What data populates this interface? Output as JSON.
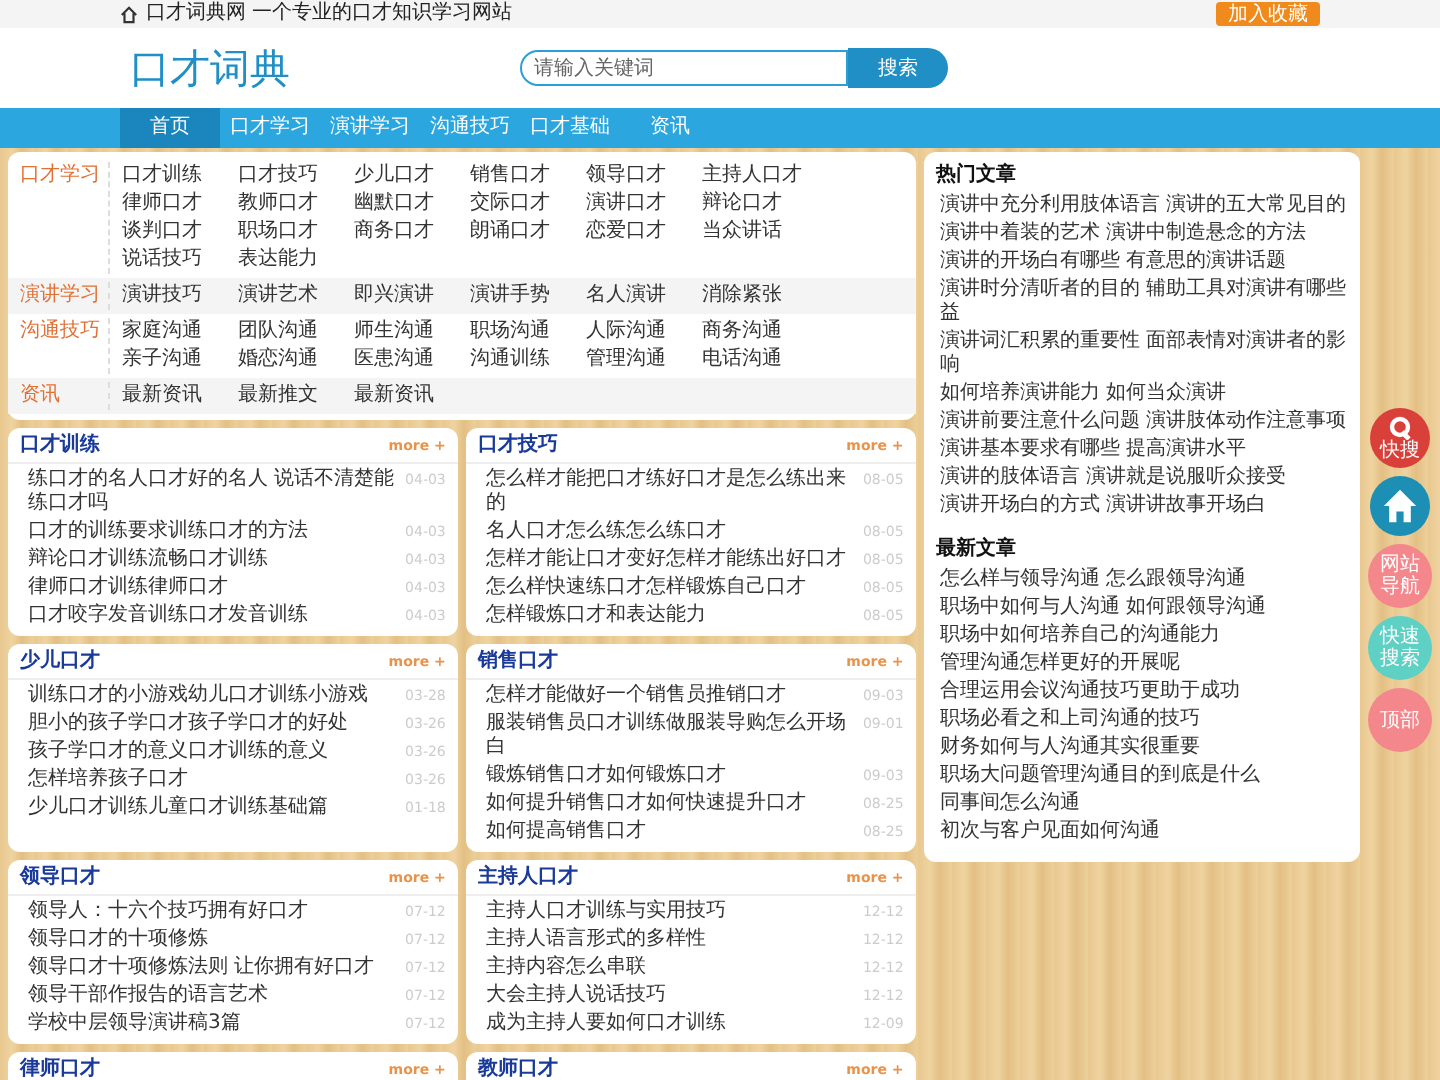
{
  "top_bar": {
    "site_intro": "口才词典网 一个专业的口才知识学习网站",
    "bookmark_button": "加入收藏"
  },
  "header": {
    "logo": "口才词典",
    "search": {
      "placeholder": "请输入关键词"
    },
    "search_button": "搜索"
  },
  "nav": [
    {
      "label": "首页",
      "selected": true
    },
    {
      "label": "口才学习",
      "selected": false
    },
    {
      "label": "演讲学习",
      "selected": false
    },
    {
      "label": "沟通技巧",
      "selected": false
    },
    {
      "label": "口才基础",
      "selected": false
    },
    {
      "label": "资讯",
      "selected": false
    }
  ],
  "categories": [
    {
      "label": "口才学习",
      "links": [
        "口才训练",
        "口才技巧",
        "少儿口才",
        "销售口才",
        "领导口才",
        "主持人口才",
        "律师口才",
        "教师口才",
        "幽默口才",
        "交际口才",
        "演讲口才",
        "辩论口才",
        "谈判口才",
        "职场口才",
        "商务口才",
        "朗诵口才",
        "恋爱口才",
        "当众讲话",
        "说话技巧",
        "表达能力"
      ]
    },
    {
      "label": "演讲学习",
      "links": [
        "演讲技巧",
        "演讲艺术",
        "即兴演讲",
        "演讲手势",
        "名人演讲",
        "消除紧张"
      ]
    },
    {
      "label": "沟通技巧",
      "links": [
        "家庭沟通",
        "团队沟通",
        "师生沟通",
        "职场沟通",
        "人际沟通",
        "商务沟通",
        "亲子沟通",
        "婚恋沟通",
        "医患沟通",
        "沟通训练",
        "管理沟通",
        "电话沟通"
      ]
    },
    {
      "label": "资讯",
      "links": [
        "最新资讯",
        "最新推文",
        "最新资讯"
      ]
    }
  ],
  "sections": [
    {
      "title": "口才训练",
      "more": "more +",
      "articles": [
        {
          "title": "练口才的名人口才好的名人 说话不清楚能练口才吗",
          "date": "04-03"
        },
        {
          "title": "口才的训练要求训练口才的方法",
          "date": "04-03"
        },
        {
          "title": "辩论口才训练流畅口才训练",
          "date": "04-03"
        },
        {
          "title": "律师口才训练律师口才",
          "date": "04-03"
        },
        {
          "title": "口才咬字发音训练口才发音训练",
          "date": "04-03"
        }
      ]
    },
    {
      "title": "口才技巧",
      "more": "more +",
      "articles": [
        {
          "title": "怎么样才能把口才练好口才是怎么练出来的",
          "date": "08-05"
        },
        {
          "title": "名人口才怎么练怎么练口才",
          "date": "08-05"
        },
        {
          "title": "怎样才能让口才变好怎样才能练出好口才",
          "date": "08-05"
        },
        {
          "title": "怎么样快速练口才怎样锻炼自己口才",
          "date": "08-05"
        },
        {
          "title": "怎样锻炼口才和表达能力",
          "date": "08-05"
        }
      ]
    },
    {
      "title": "少儿口才",
      "more": "more +",
      "articles": [
        {
          "title": "训练口才的小游戏幼儿口才训练小游戏",
          "date": "03-28"
        },
        {
          "title": "胆小的孩子学口才孩子学口才的好处",
          "date": "03-26"
        },
        {
          "title": "孩子学口才的意义口才训练的意义",
          "date": "03-26"
        },
        {
          "title": "怎样培养孩子口才",
          "date": "03-26"
        },
        {
          "title": "少儿口才训练儿童口才训练基础篇",
          "date": "01-18"
        }
      ]
    },
    {
      "title": "销售口才",
      "more": "more +",
      "articles": [
        {
          "title": "怎样才能做好一个销售员推销口才",
          "date": "09-03"
        },
        {
          "title": "服装销售员口才训练做服装导购怎么开场白",
          "date": "09-01"
        },
        {
          "title": "锻炼销售口才如何锻炼口才",
          "date": "09-03"
        },
        {
          "title": "如何提升销售口才如何快速提升口才",
          "date": "08-25"
        },
        {
          "title": "如何提高销售口才",
          "date": "08-25"
        }
      ]
    },
    {
      "title": "领导口才",
      "more": "more +",
      "articles": [
        {
          "title": "领导人：十六个技巧拥有好口才",
          "date": "07-12"
        },
        {
          "title": "领导口才的十项修炼",
          "date": "07-12"
        },
        {
          "title": "领导口才十项修炼法则 让你拥有好口才",
          "date": "07-12"
        },
        {
          "title": "领导干部作报告的语言艺术",
          "date": "07-12"
        },
        {
          "title": "学校中层领导演讲稿3篇",
          "date": "07-12"
        }
      ]
    },
    {
      "title": "主持人口才",
      "more": "more +",
      "articles": [
        {
          "title": "主持人口才训练与实用技巧",
          "date": "12-12"
        },
        {
          "title": "主持人语言形式的多样性",
          "date": "12-12"
        },
        {
          "title": "主持内容怎么串联",
          "date": "12-12"
        },
        {
          "title": "大会主持人说话技巧",
          "date": "12-12"
        },
        {
          "title": "成为主持人要如何口才训练",
          "date": "12-09"
        }
      ]
    },
    {
      "title": "律师口才",
      "more": "more +"
    },
    {
      "title": "教师口才",
      "more": "more +"
    }
  ],
  "sidebar": {
    "hot_title": "热门文章",
    "hot": [
      "演讲中充分利用肢体语言 演讲的五大常见目的",
      "演讲中着装的艺术 演讲中制造悬念的方法",
      "演讲的开场白有哪些 有意思的演讲话题",
      "演讲时分清听者的目的 辅助工具对演讲有哪些益",
      "演讲词汇积累的重要性 面部表情对演讲者的影响",
      "如何培养演讲能力 如何当众演讲",
      "演讲前要注意什么问题 演讲肢体动作注意事项",
      "演讲基本要求有哪些 提高演讲水平",
      "演讲的肢体语言 演讲就是说服听众接受",
      "演讲开场白的方式 演讲讲故事开场白"
    ],
    "latest_title": "最新文章",
    "latest": [
      "怎么样与领导沟通 怎么跟领导沟通",
      "职场中如何与人沟通 如何跟领导沟通",
      "职场中如何培养自己的沟通能力",
      "管理沟通怎样更好的开展呢",
      "合理运用会议沟通技巧更助于成功",
      "职场必看之和上司沟通的技巧",
      "财务如何与人沟通其实很重要",
      "职场大问题管理沟通目的到底是什么",
      "同事间怎么沟通",
      "初次与客户见面如何沟通"
    ]
  },
  "float_buttons": [
    {
      "kind": "search",
      "label": "快搜",
      "color": "#d9403a"
    },
    {
      "kind": "home",
      "color": "#1d8fb5"
    },
    {
      "kind": "text",
      "label": "网站导航",
      "color": "#f3878c"
    },
    {
      "kind": "text",
      "label": "快速搜索",
      "color": "#5fd0c4"
    },
    {
      "kind": "text",
      "label": "顶部",
      "color": "#f3878c"
    }
  ]
}
